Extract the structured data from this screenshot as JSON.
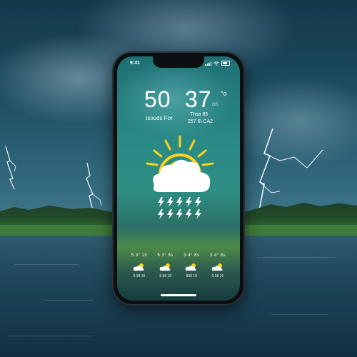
{
  "status_bar": {
    "time": "9:41"
  },
  "weather": {
    "temp_left": "50",
    "temp_right": "37",
    "degree_mark": "°o",
    "small_os": "OS",
    "label_left": "Isoods For",
    "label_right_1": "Thsa 85",
    "label_right_2": "257 6\\ CA2",
    "condition_icon": "sun-behind-cloud-icon",
    "storm_icon": "lightning-bolt-icon"
  },
  "forecast": [
    {
      "top": "5 3° 10",
      "icon": "cloud-sun-icon",
      "bottom": "8 58 10"
    },
    {
      "top": "5 3° 8s",
      "icon": "cloud-sun-icon",
      "bottom": "8 58 18"
    },
    {
      "top": "3 4° 8s",
      "icon": "cloud-sun-icon",
      "bottom": "838 18"
    },
    {
      "top": "3 4° 8s",
      "icon": "cloud-sun-icon",
      "bottom": "0 58 10"
    }
  ],
  "colors": {
    "accent_sun": "#ffd21a",
    "cloud": "#ffffff",
    "screen_top": "#1f6f73"
  }
}
